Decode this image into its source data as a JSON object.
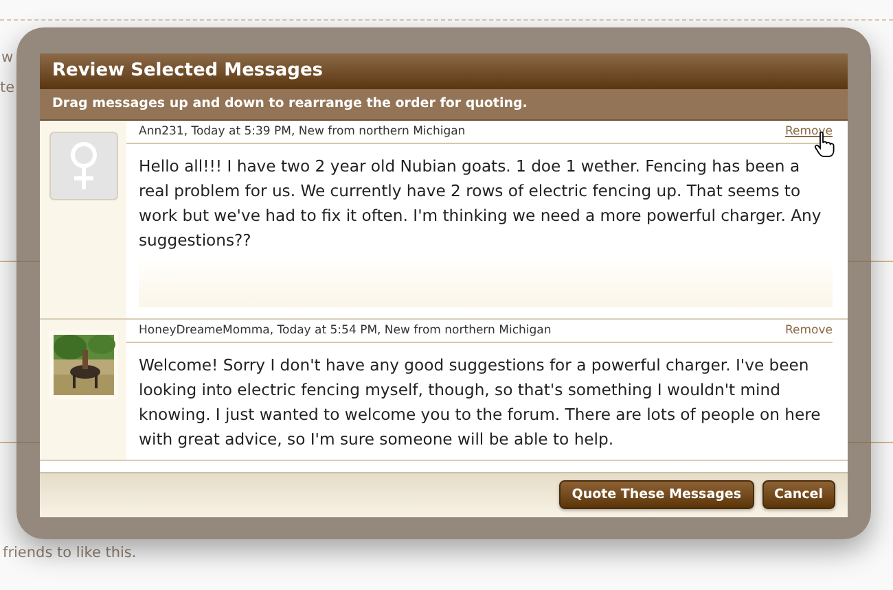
{
  "background_page": {
    "fragments": [
      {
        "kind": "text",
        "text": "w"
      },
      {
        "kind": "text",
        "text": "te"
      },
      {
        "kind": "text",
        "text": "friends to like this."
      }
    ]
  },
  "dialog": {
    "title": "Review Selected Messages",
    "subtitle": "Drag messages up and down to rearrange the order for quoting.",
    "messages": [
      {
        "avatar": {
          "kind": "female-placeholder"
        },
        "header": "Ann231, Today at 5:39 PM, New from northern Michigan",
        "remove": "Remove",
        "remove_hovered": true,
        "body": "Hello all!!! I have two 2 year old Nubian goats. 1 doe 1 wether. Fencing has been a real problem for us. We currently have 2 rows of electric fencing up. That seems to work but we've had to fix it often. I'm thinking we need a more powerful charger. Any suggestions??",
        "faded_tail": true
      },
      {
        "header": "HoneyDreameMomma, Today at 5:54 PM, New from northern Michigan",
        "remove": "Remove",
        "remove_hovered": false,
        "body": "Welcome! Sorry I don't have any good suggestions for a powerful charger. I've been looking into electric fencing myself, though, so that's something I wouldn't mind knowing. I just wanted to welcome you to the forum. There are lots of people on here with great advice, so I'm sure someone will be able to help.",
        "faded_tail": false
      }
    ],
    "buttons": [
      "Quote These Messages",
      "Cancel"
    ]
  }
}
